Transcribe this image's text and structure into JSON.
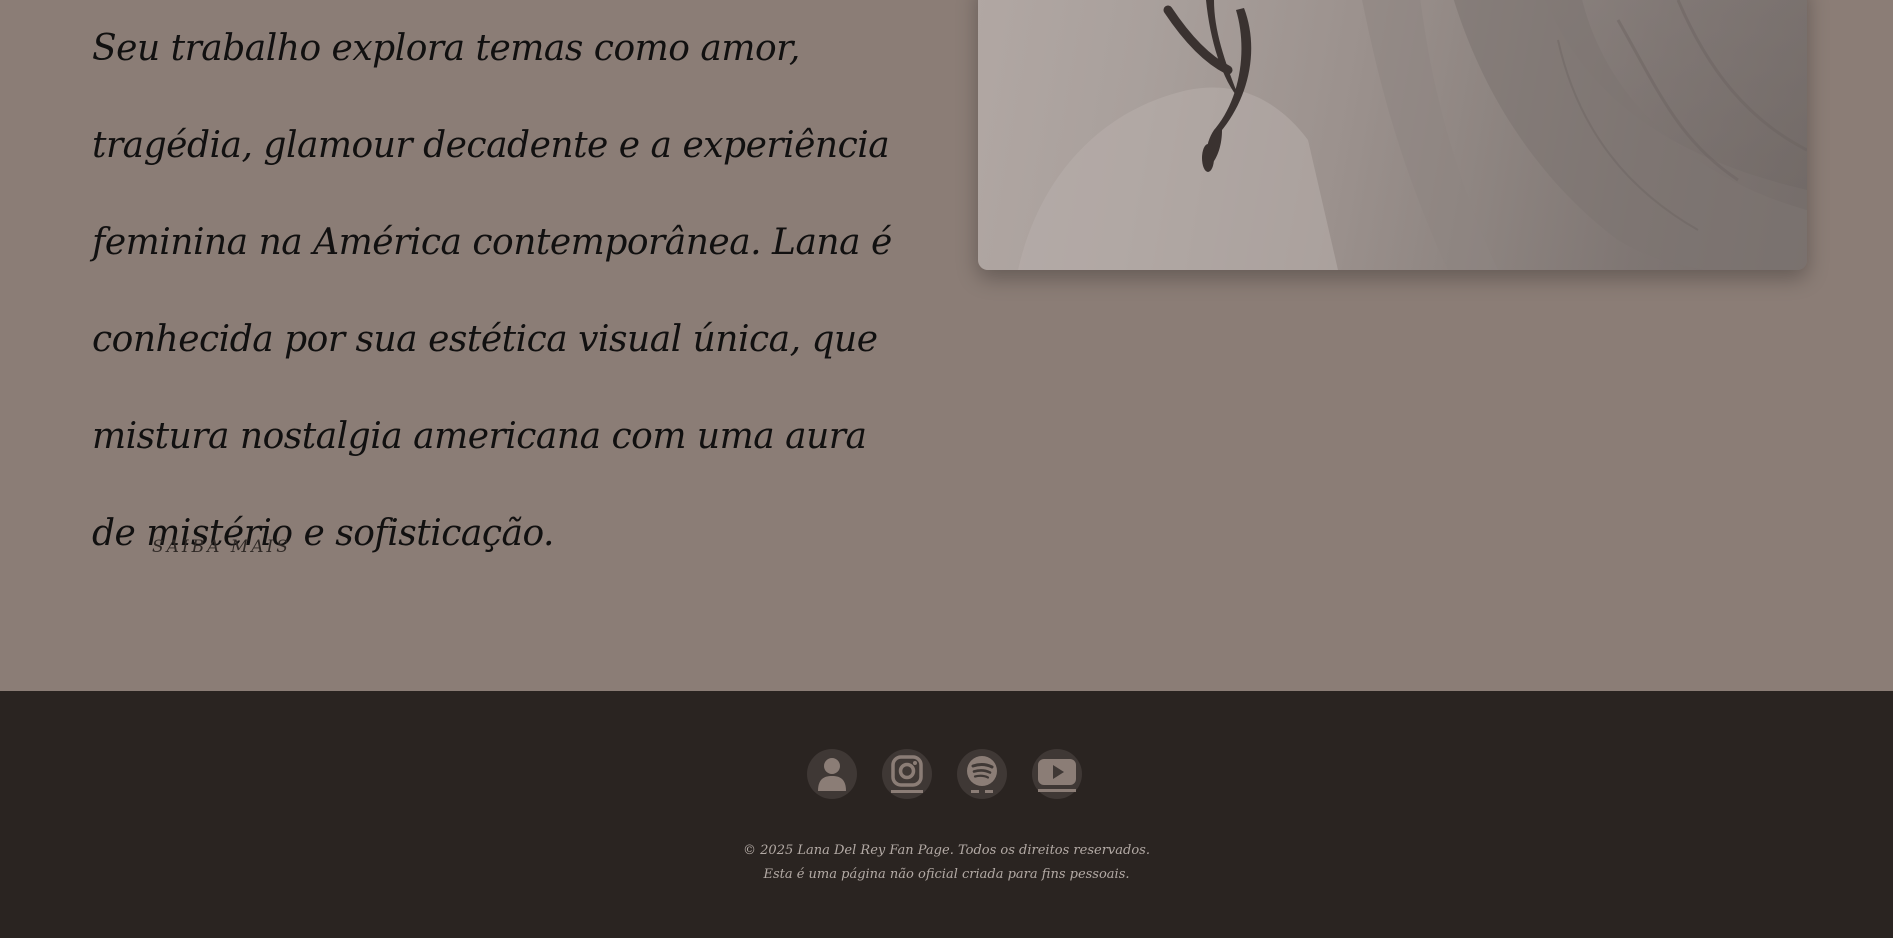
{
  "about": {
    "paragraph": "Seu trabalho explora temas como amor, tragédia, glamour decadente e a experiência feminina na América contemporânea. Lana é conhecida por sua estética visual única, que mistura nostalgia americana com uma aura de mistério e sofisticação.",
    "learn_more_label": "SAIBA MAIS"
  },
  "footer": {
    "social_icons": [
      "user-icon",
      "instagram-icon",
      "spotify-icon",
      "youtube-icon"
    ],
    "copyright": "© 2025 Lana Del Rey Fan Page. Todos os direitos reservados.",
    "disclaimer": "Esta é uma página não oficial criada para fins pessoais."
  },
  "colors": {
    "section_background": "#8b7d76",
    "footer_background": "#2a2421",
    "icon_circle": "#3f3835",
    "icon_glyph": "#8b7d76",
    "text_dark": "#111010",
    "footer_text": "#b3aaa5"
  }
}
